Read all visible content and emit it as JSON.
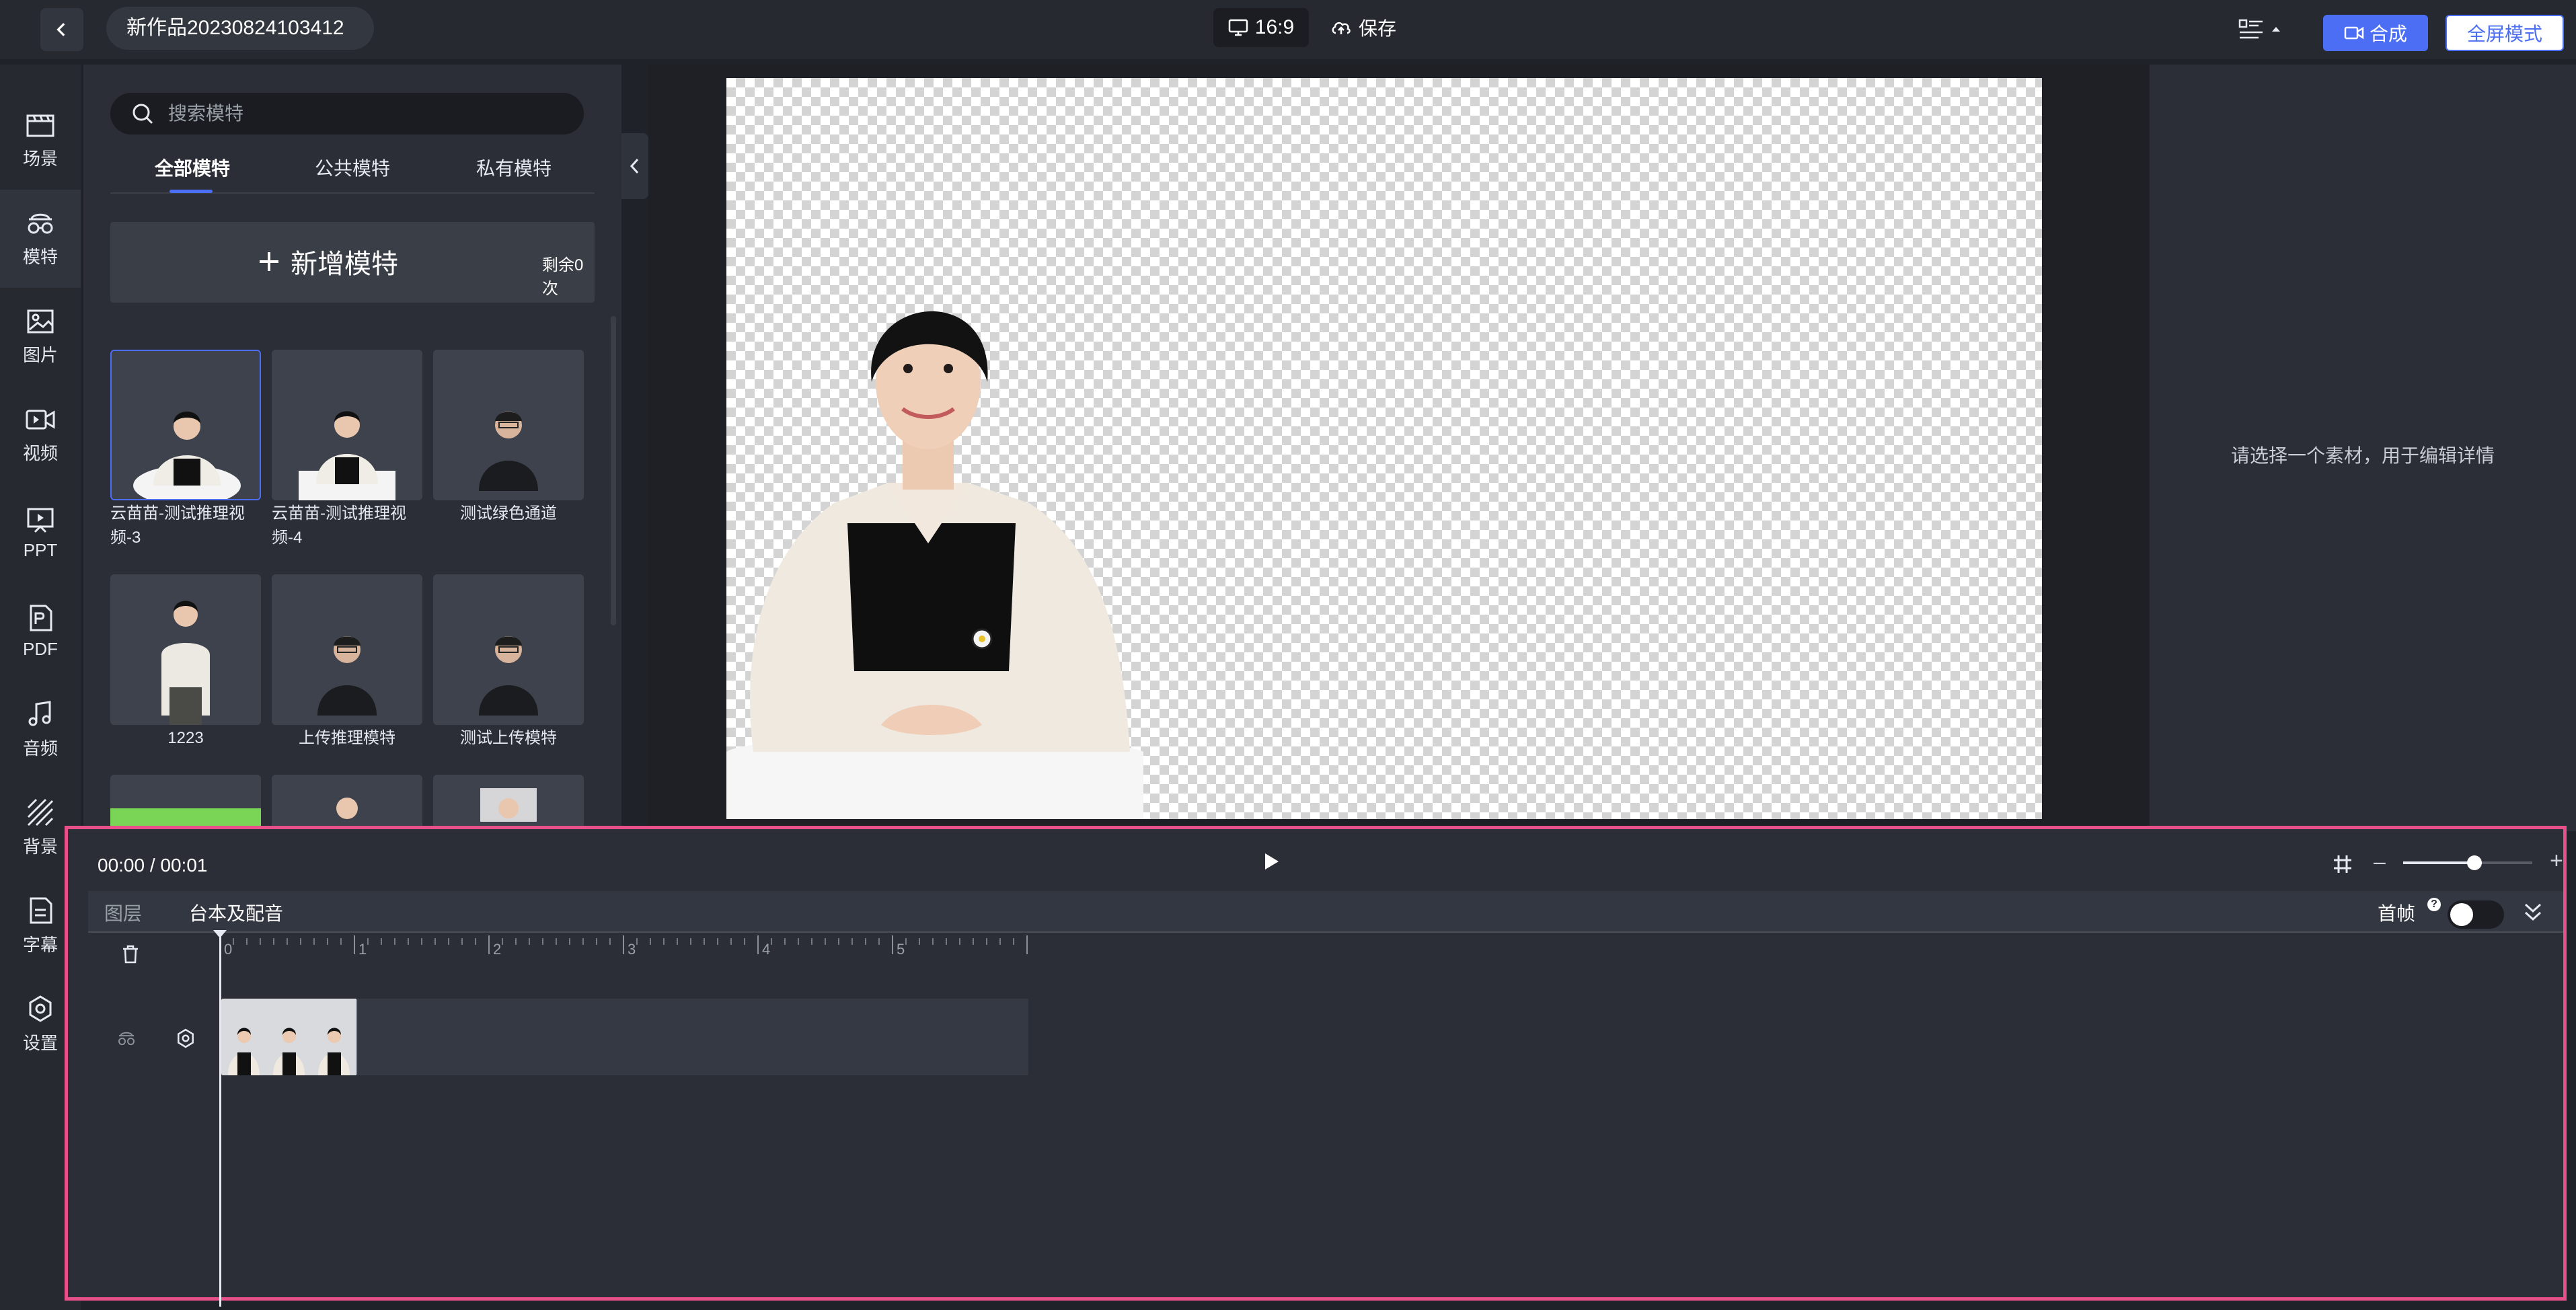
{
  "topbar": {
    "title": "新作品20230824103412",
    "ratio": "16:9",
    "save": "保存",
    "compose": "合成",
    "fullscreen": "全屏模式"
  },
  "sidebar": {
    "items": [
      {
        "label": "场景",
        "icon": "scene-icon"
      },
      {
        "label": "模特",
        "icon": "model-icon"
      },
      {
        "label": "图片",
        "icon": "image-icon"
      },
      {
        "label": "视频",
        "icon": "video-icon"
      },
      {
        "label": "PPT",
        "icon": "ppt-icon"
      },
      {
        "label": "PDF",
        "icon": "pdf-icon"
      },
      {
        "label": "音频",
        "icon": "audio-icon"
      },
      {
        "label": "背景",
        "icon": "background-icon"
      },
      {
        "label": "字幕",
        "icon": "subtitle-icon"
      },
      {
        "label": "设置",
        "icon": "settings-icon"
      }
    ]
  },
  "panel": {
    "search_placeholder": "搜索模特",
    "tabs": [
      "全部模特",
      "公共模特",
      "私有模特"
    ],
    "add_label": "新增模特",
    "remaining": "剩余0次",
    "models": [
      {
        "label": "云苗苗-测试推理视频-3"
      },
      {
        "label": "云苗苗-测试推理视频-4"
      },
      {
        "label": "测试绿色通道"
      },
      {
        "label": "1223"
      },
      {
        "label": "上传推理模特"
      },
      {
        "label": "测试上传模特"
      }
    ]
  },
  "right_panel": {
    "hint": "请选择一个素材，用于编辑详情"
  },
  "timeline": {
    "time": "00:00 / 00:01",
    "tabs": [
      "图层",
      "台本及配音"
    ],
    "first_frame": "首帧",
    "ruler_labels": [
      "0",
      "1",
      "2",
      "3",
      "4",
      "5"
    ],
    "zoom": 0.55
  },
  "colors": {
    "accent": "#4b6ef5",
    "highlight_border": "#e8508a"
  }
}
